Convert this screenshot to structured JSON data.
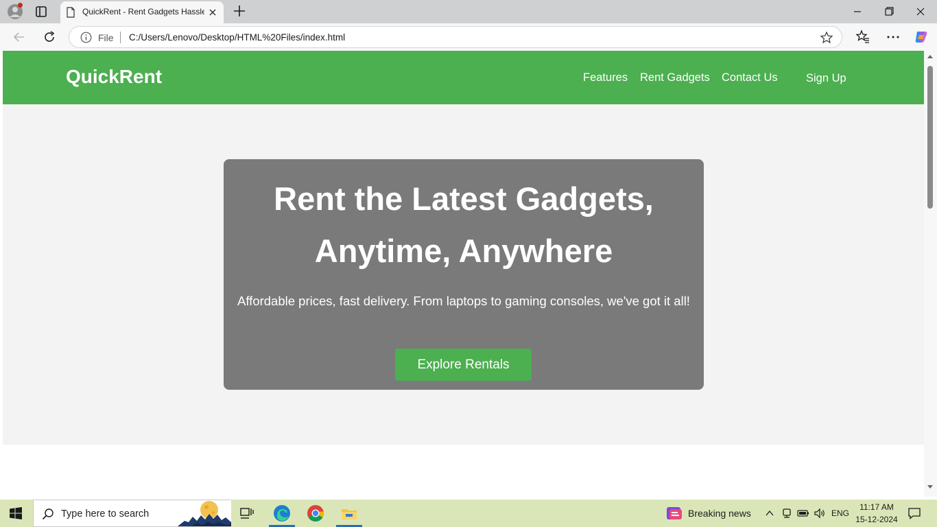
{
  "browser": {
    "tab": {
      "title": "QuickRent - Rent Gadgets Hassle-Free",
      "icon": "page-icon"
    },
    "address_bar": {
      "scheme_label": "File",
      "url": "C:/Users/Lenovo/Desktop/HTML%20Files/index.html"
    }
  },
  "site": {
    "logo": "QuickRent",
    "nav": {
      "features": "Features",
      "rent_gadgets": "Rent Gadgets",
      "contact_us": "Contact Us",
      "sign_up": "Sign Up"
    },
    "hero": {
      "title_line1": "Rent the Latest Gadgets,",
      "title_line2": "Anytime, Anywhere",
      "subtitle": "Affordable prices, fast delivery. From laptops to gaming consoles, we've got it all!",
      "button": "Explore Rentals"
    },
    "colors": {
      "brand_green": "#4caf50",
      "hero_card": "#7a7a7a",
      "page_bg": "#f3f3f3"
    }
  },
  "taskbar": {
    "search_placeholder": "Type here to search",
    "apps": [
      "edge-icon",
      "chrome-icon",
      "file-explorer-icon"
    ],
    "news": "Breaking news",
    "language": "ENG",
    "time": "11:17 AM",
    "date": "15-12-2024"
  }
}
